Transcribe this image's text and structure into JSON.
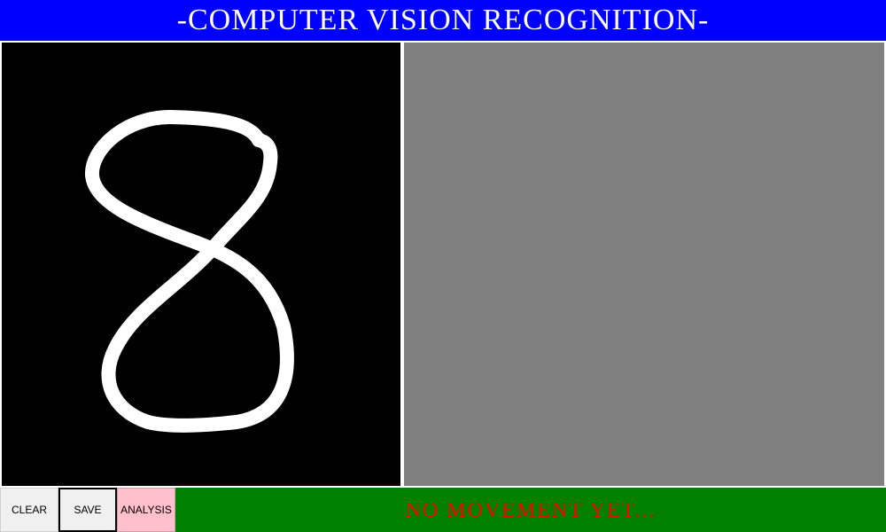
{
  "header": {
    "title": "-COMPUTER VISION RECOGNITION-"
  },
  "canvas": {
    "background_color": "#000000",
    "stroke_color": "#ffffff",
    "drawn_content": "handwritten digit 8"
  },
  "result_panel": {
    "background_color": "#808080"
  },
  "toolbar": {
    "clear_label": "CLEAR",
    "save_label": "SAVE",
    "analysis_label": "ANALYSIS"
  },
  "status": {
    "text": "NO MOVEMENT YET...",
    "text_color": "#ff0000",
    "background_color": "#008000"
  },
  "colors": {
    "title_bar": "#0000ff",
    "analysis_button": "#ffc0cb",
    "button_default": "#f0f0f0"
  }
}
